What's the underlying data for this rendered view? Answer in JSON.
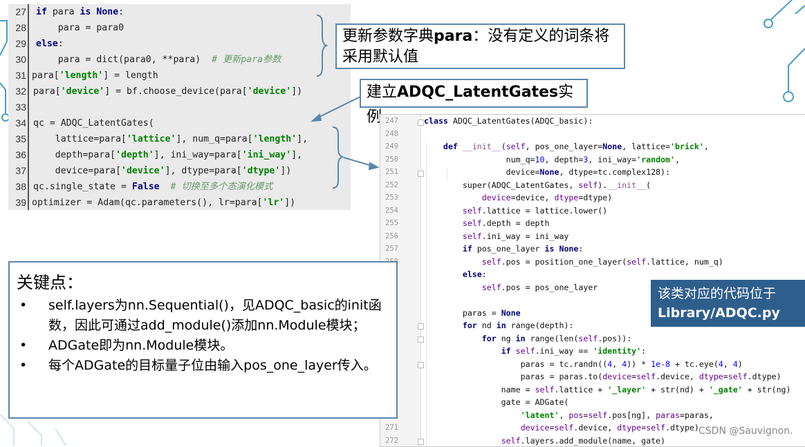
{
  "left_code": [
    {
      "ln": "27",
      "html_key": "l27"
    },
    {
      "ln": "28",
      "html_key": "l28"
    },
    {
      "ln": "29",
      "html_key": "l29"
    },
    {
      "ln": "30",
      "html_key": "l30"
    },
    {
      "ln": "31",
      "html_key": "l31"
    },
    {
      "ln": "32",
      "html_key": "l32"
    },
    {
      "ln": "33",
      "html_key": "l33"
    },
    {
      "ln": "34",
      "html_key": "l34"
    },
    {
      "ln": "35",
      "html_key": "l35"
    },
    {
      "ln": "36",
      "html_key": "l36"
    },
    {
      "ln": "37",
      "html_key": "l37"
    },
    {
      "ln": "38",
      "html_key": "l38"
    },
    {
      "ln": "39",
      "html_key": "l39"
    }
  ],
  "callout_para": {
    "prefix": "更新参数字典",
    "bold": "para",
    "suffix": "：没有定义的词条将采用默认值"
  },
  "callout_inst": {
    "prefix": "建立",
    "bold": "ADQC_LatentGates",
    "suffix": "实例"
  },
  "right_line_numbers": [
    "247",
    "248",
    "249",
    "250",
    "251",
    "252",
    "253",
    "254",
    "255",
    "256",
    "257",
    "258",
    "",
    "",
    "",
    "",
    "",
    "",
    "",
    "",
    "",
    "",
    "",
    "271",
    "272"
  ],
  "note_blue": {
    "line1": "该类对应的代码位于",
    "line2": "Library/ADQC.py"
  },
  "keypoints": {
    "title": "关键点：",
    "bullet": "•",
    "items": [
      "self.layers为nn.Sequential()，见ADQC_basic的init函数，因此可通过add_module()添加nn.Module模块；",
      "ADGate即为nn.Module模块。",
      "每个ADGate的目标量子位由输入pos_one_layer传入。"
    ]
  },
  "watermark": "CSDN @Sauvignon.",
  "colors": {
    "callout_border": "#5b87ad",
    "note_bg": "#2e5e8c",
    "keyword": "#000080",
    "string": "#008000",
    "comment": "#6a9a6a"
  }
}
